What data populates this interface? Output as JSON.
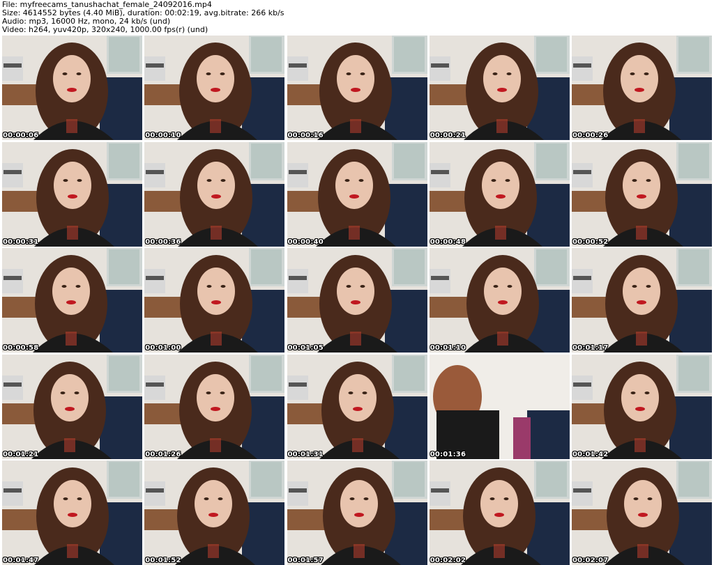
{
  "header": {
    "line1": "File: myfreecams_tanushachat_female_24092016.mp4",
    "line2": "Size: 4614552 bytes (4.40 MiB), duration: 00:02:19, avg.bitrate: 266 kb/s",
    "line3": "Audio: mp3, 16000 Hz, mono, 24 kb/s (und)",
    "line4": "Video: h264, yuv420p, 320x240, 1000.00 fps(r) (und)"
  },
  "thumbnails": [
    {
      "timestamp": "00:00:06"
    },
    {
      "timestamp": "00:00:10"
    },
    {
      "timestamp": "00:00:16"
    },
    {
      "timestamp": "00:00:21"
    },
    {
      "timestamp": "00:00:26"
    },
    {
      "timestamp": "00:00:31"
    },
    {
      "timestamp": "00:00:36"
    },
    {
      "timestamp": "00:00:40"
    },
    {
      "timestamp": "00:00:48"
    },
    {
      "timestamp": "00:00:52"
    },
    {
      "timestamp": "00:00:58"
    },
    {
      "timestamp": "00:01:00"
    },
    {
      "timestamp": "00:01:05"
    },
    {
      "timestamp": "00:01:10"
    },
    {
      "timestamp": "00:01:17"
    },
    {
      "timestamp": "00:01:21"
    },
    {
      "timestamp": "00:01:26"
    },
    {
      "timestamp": "00:01:31"
    },
    {
      "timestamp": "00:01:36"
    },
    {
      "timestamp": "00:01:42"
    },
    {
      "timestamp": "00:01:47"
    },
    {
      "timestamp": "00:01:52"
    },
    {
      "timestamp": "00:01:57"
    },
    {
      "timestamp": "00:02:02"
    },
    {
      "timestamp": "00:02:07"
    }
  ],
  "colors": {
    "wall": "#e6e2dc",
    "shelf": "#8a5a3a",
    "couch": "#1c2a44",
    "hair": "#4a2a1c",
    "skin": "#e8c4ae",
    "shirt": "#1a1a1a",
    "lips": "#c01820"
  }
}
